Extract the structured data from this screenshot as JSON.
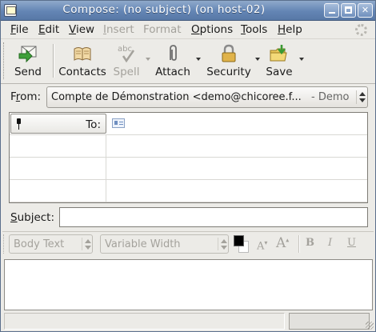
{
  "window": {
    "title": "Compose: (no subject) (on host-02)"
  },
  "menubar": {
    "items": [
      {
        "label": "File",
        "accel": "F",
        "rest": "ile",
        "enabled": true
      },
      {
        "label": "Edit",
        "accel": "E",
        "rest": "dit",
        "enabled": true
      },
      {
        "label": "View",
        "accel": "V",
        "rest": "iew",
        "enabled": true
      },
      {
        "label": "Insert",
        "accel": "I",
        "rest": "nsert",
        "enabled": false
      },
      {
        "label": "Format",
        "accel": "",
        "rest": "Format",
        "enabled": false
      },
      {
        "label": "Options",
        "accel": "O",
        "rest": "ptions",
        "enabled": true
      },
      {
        "label": "Tools",
        "accel": "T",
        "rest": "ools",
        "enabled": true
      },
      {
        "label": "Help",
        "accel": "H",
        "rest": "elp",
        "enabled": true
      }
    ]
  },
  "toolbar": {
    "send": "Send",
    "contacts": "Contacts",
    "spell": "Spell",
    "spell_icon_text": "abc",
    "attach": "Attach",
    "security": "Security",
    "save": "Save"
  },
  "from": {
    "label": "From:",
    "accel": "r",
    "value": "Compte de Démonstration <demo@chicoree.f...",
    "suffix": "- Demo"
  },
  "address": {
    "rows": [
      {
        "type": "To:",
        "value": ""
      },
      {
        "type": "",
        "value": ""
      },
      {
        "type": "",
        "value": ""
      },
      {
        "type": "",
        "value": ""
      }
    ]
  },
  "subject": {
    "label": "Subject:",
    "accel": "S",
    "value": ""
  },
  "format": {
    "paragraph_style": "Body Text",
    "font_family": "Variable Width",
    "smaller": "A",
    "larger": "A",
    "bold": "B",
    "italic": "I",
    "underline": "U"
  },
  "colors": {
    "titlebar": "#6385b4",
    "text_color": "#000000",
    "background_color": "#ffffff"
  }
}
